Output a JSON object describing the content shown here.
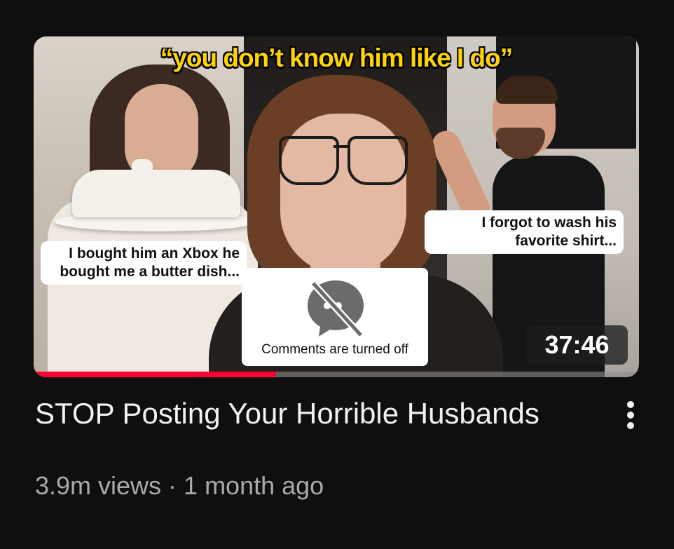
{
  "thumbnail": {
    "overlay_title": "“you don’t know him like I do”",
    "caption_left": "I bought him an Xbox he bought me a butter dish...",
    "caption_right": "I forgot to wash his favorite shirt...",
    "comments_notice": "Comments are turned off",
    "duration": "37:46",
    "watch_progress": 0.4,
    "progress_color": "#ff0033"
  },
  "video": {
    "title": "STOP Posting Your Horrible Husbands",
    "meta": "3.9m views · 1 month ago",
    "menu_icon": "vertical-ellipsis-icon"
  },
  "colors": {
    "background": "#0f0f0f",
    "title_text": "#f1f1f1",
    "meta_text": "#aaaaaa",
    "overlay_title": "#ffd400"
  }
}
